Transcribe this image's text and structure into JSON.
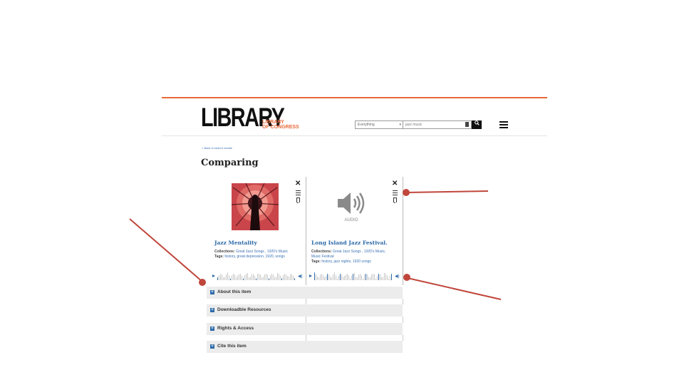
{
  "header": {
    "logo_main": "LIBRARY",
    "logo_sub_line1": "LIBRARY",
    "logo_sub_line2": "OF CONGRESS",
    "search_scope": "Everything",
    "search_query": "jazz music"
  },
  "nav": {
    "back_link": "< Back to search results"
  },
  "page": {
    "title": "Comparing"
  },
  "items": [
    {
      "title": "Jazz Mentality",
      "collections_label": "Collections:",
      "collections": "Great Jazz Songs , 1920's Music",
      "tags_label": "Tags:",
      "tags": "history, great depression, 1920, songs"
    },
    {
      "media_label": "AUDIO",
      "title": "Long Island Jazz Festival.",
      "collections_label": "Collections:",
      "collections_line1": "Great Jazz Songs , 1920's Music,",
      "collections_line2": "Music Festival",
      "tags_label": "Tags:",
      "tags": "history, jazz nights, 1920 songs"
    }
  ],
  "accordion": [
    {
      "label": "About this item"
    },
    {
      "label": "Downloadble Resources"
    },
    {
      "label": "Rights & Access"
    },
    {
      "label": "Cite this item"
    }
  ],
  "colors": {
    "accent": "#e86a3a",
    "link": "#3b72b5",
    "annotation": "#c0463b"
  }
}
